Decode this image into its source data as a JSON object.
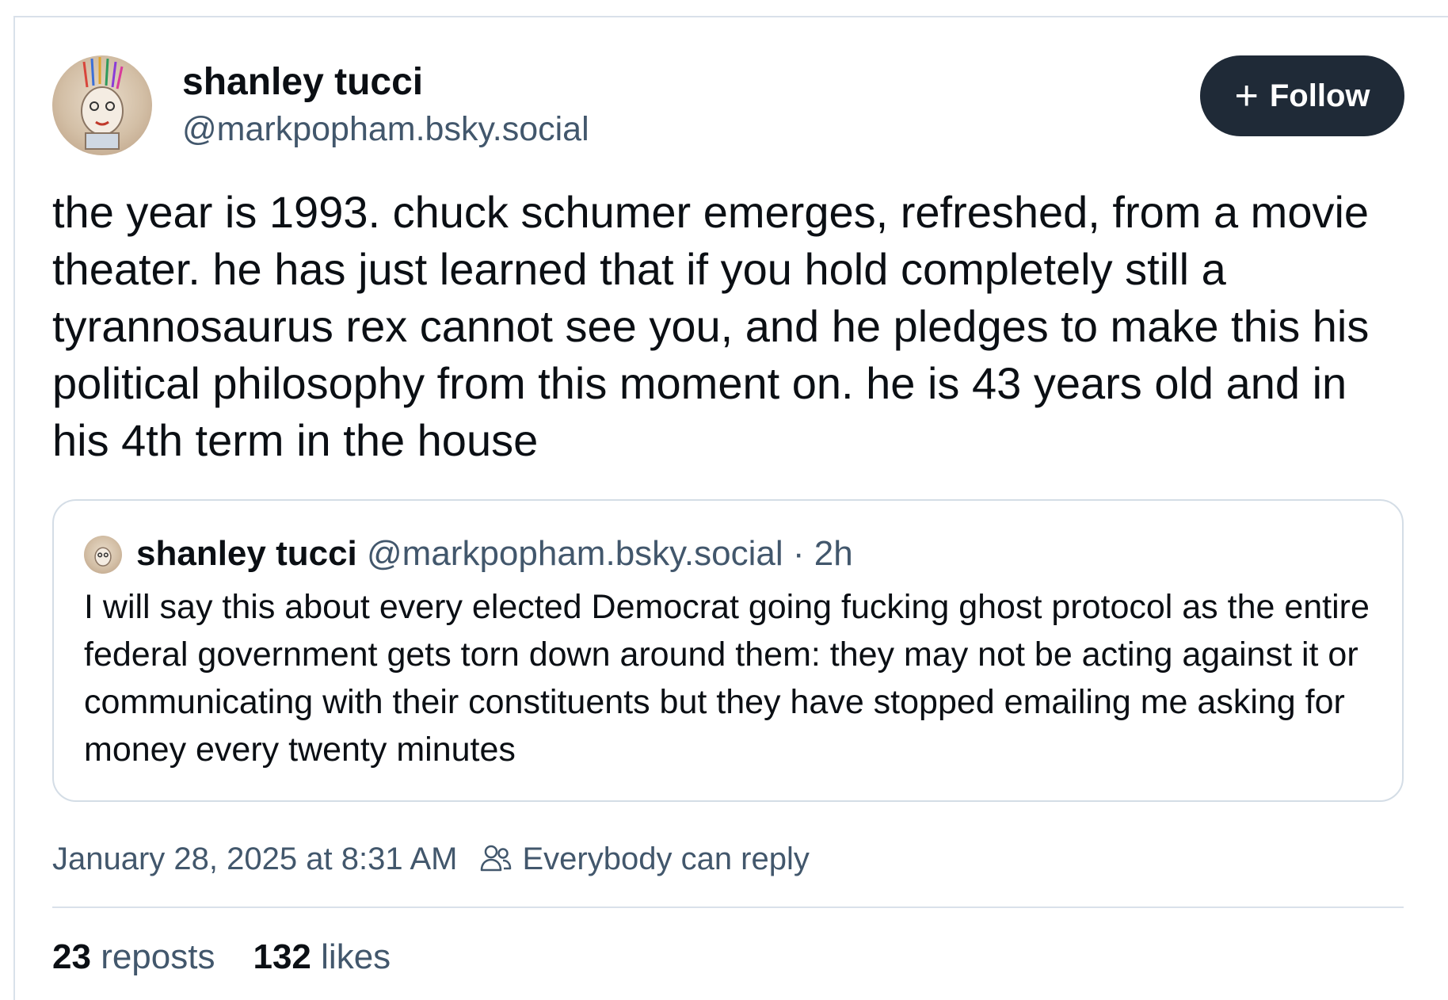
{
  "post": {
    "author": {
      "name": "shanley tucci",
      "handle": "@markpopham.bsky.social"
    },
    "follow_button": {
      "icon": "plus-icon",
      "label": "Follow"
    },
    "text": "the year is 1993. chuck schumer emerges, refreshed, from a movie theater. he has just learned that if you hold completely still a tyrannosaurus rex cannot see you, and he pledges to make this his political philosophy from this moment on. he is 43 years old and in his 4th term in the house",
    "quoted_post": {
      "author_name": "shanley tucci",
      "author_handle": "@markpopham.bsky.social",
      "separator": "·",
      "age": "2h",
      "text": "I will say this about every elected Democrat going fucking ghost protocol as the entire federal government gets torn down around them: they may not be acting against it or communicating with their constituents but they have stopped emailing me asking for money every twenty minutes"
    },
    "timestamp": "January 28, 2025 at 8:31 AM",
    "reply_setting": {
      "icon": "people-icon",
      "label": "Everybody can reply"
    },
    "stats": {
      "reposts_count": "23",
      "reposts_label": "reposts",
      "likes_count": "132",
      "likes_label": "likes"
    }
  },
  "colors": {
    "text_primary": "#0b0f14",
    "text_secondary": "#42576c",
    "button_bg": "#1f2a37",
    "border": "#d9e1ea"
  }
}
